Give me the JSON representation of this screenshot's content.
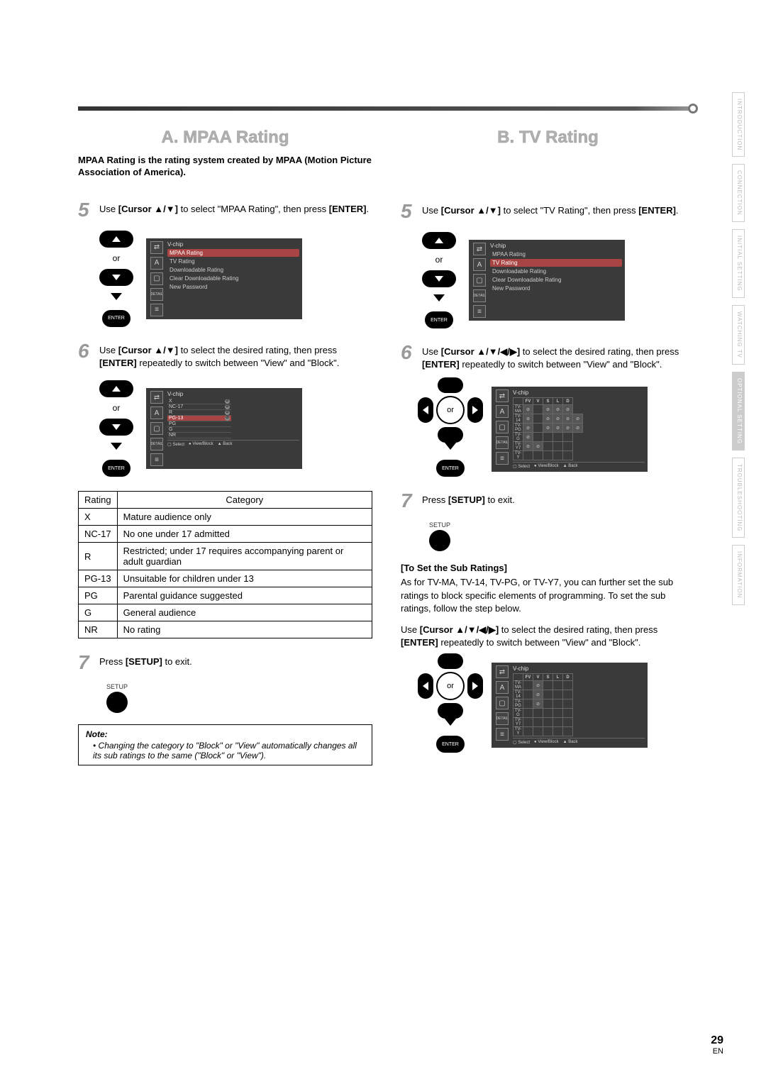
{
  "page": {
    "number": "29",
    "lang": "EN"
  },
  "tabs": [
    "INTRODUCTION",
    "CONNECTION",
    "INITIAL SETTING",
    "WATCHING TV",
    "OPTIONAL SETTING",
    "TROUBLESHOOTING",
    "INFORMATION"
  ],
  "active_tab": "OPTIONAL SETTING",
  "colA": {
    "title": "A.  MPAA Rating",
    "intro": "MPAA Rating is the rating system created by MPAA (Motion Picture Association of America).",
    "step5": {
      "pre": "Use ",
      "cursor": "[Cursor ▲/▼]",
      "mid": " to select \"MPAA Rating\", then press ",
      "enter": "[ENTER]",
      "post": "."
    },
    "step6": {
      "pre": "Use ",
      "cursor": "[Cursor ▲/▼]",
      "mid": " to select the desired rating, then press ",
      "enter": "[ENTER]",
      "post": " repeatedly to switch between \"View\" and \"Block\"."
    },
    "step7": {
      "pre": "Press ",
      "setup": "[SETUP]",
      "post": " to exit."
    },
    "or": "or",
    "setup_label": "SETUP",
    "enter_label": "ENTER",
    "osd_title": "V-chip",
    "osd_items": [
      "MPAA Rating",
      "TV Rating",
      "Downloadable Rating",
      "Clear Downloadable Rating",
      "New Password"
    ],
    "osd_hl_index": 0,
    "detail": "DETAIL",
    "mpaa_ratings": [
      "X",
      "NC-17",
      "R",
      "PG-13",
      "PG",
      "G",
      "NR"
    ],
    "osd_footer": {
      "select": "Select",
      "viewblock": "View/Block",
      "back": "Back"
    },
    "table": {
      "headers": [
        "Rating",
        "Category"
      ],
      "rows": [
        [
          "X",
          "Mature audience only"
        ],
        [
          "NC-17",
          "No one under 17 admitted"
        ],
        [
          "R",
          "Restricted; under 17 requires accompanying parent or adult guardian"
        ],
        [
          "PG-13",
          "Unsuitable for children under 13"
        ],
        [
          "PG",
          "Parental guidance suggested"
        ],
        [
          "G",
          "General audience"
        ],
        [
          "NR",
          "No rating"
        ]
      ]
    },
    "note": {
      "title": "Note:",
      "items": [
        "Changing the category to \"Block\" or \"View\" automatically changes all its sub ratings to the same (\"Block\" or \"View\")."
      ]
    }
  },
  "colB": {
    "title": "B.  TV Rating",
    "step5": {
      "pre": "Use ",
      "cursor": "[Cursor ▲/▼]",
      "mid": " to select \"TV Rating\", then press ",
      "enter": "[ENTER]",
      "post": "."
    },
    "step6": {
      "pre": "Use ",
      "cursor": "[Cursor ▲/▼/◀/▶]",
      "mid": " to select the desired rating, then press ",
      "enter": "[ENTER]",
      "post": " repeatedly to switch between \"View\" and \"Block\"."
    },
    "step7": {
      "pre": "Press ",
      "setup": "[SETUP]",
      "post": " to exit."
    },
    "or": "or",
    "setup_label": "SETUP",
    "enter_label": "ENTER",
    "osd_title": "V-chip",
    "osd_items": [
      "MPAA Rating",
      "TV Rating",
      "Downloadable Rating",
      "Clear Downloadable Rating",
      "New Password"
    ],
    "osd_hl_index": 1,
    "detail": "DETAIL",
    "tv_cols": [
      "FV",
      "V",
      "S",
      "L",
      "D"
    ],
    "tv_rows": [
      "TV-MA",
      "TV-14",
      "TV-PG",
      "TV-G",
      "TV-Y7",
      "TV-Y"
    ],
    "osd_footer": {
      "select": "Select",
      "viewblock": "View/Block",
      "back": "Back"
    },
    "sub_heading": "[To Set the Sub Ratings]",
    "sub_body1": "As for TV-MA, TV-14, TV-PG, or TV-Y7, you can further set the sub ratings to block specific elements of programming. To set the sub ratings, follow the step below.",
    "sub_body2_pre": "Use ",
    "sub_body2_cursor": "[Cursor ▲/▼/◀/▶]",
    "sub_body2_mid": " to select the desired rating, then press ",
    "sub_body2_enter": "[ENTER]",
    "sub_body2_post": " repeatedly to switch between \"View\" and \"Block\"."
  }
}
